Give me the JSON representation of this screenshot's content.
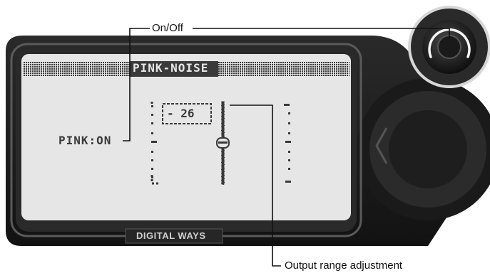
{
  "callouts": {
    "on_off": "On/Off",
    "output_range": "Output range adjustment"
  },
  "display": {
    "title": "PINK-NOISE",
    "pink_status": "PINK:ON",
    "level_value": "- 26"
  },
  "device": {
    "brand": "DIGITAL WAYS"
  },
  "icons": [
    "rotary-knob-icon",
    "left-arrow-icon",
    "slider-handle-icon"
  ],
  "colors": {
    "lcd_background": "#e6e6e6",
    "device_body": "#1c1c1c",
    "lcd_text": "#3a3a3a"
  }
}
